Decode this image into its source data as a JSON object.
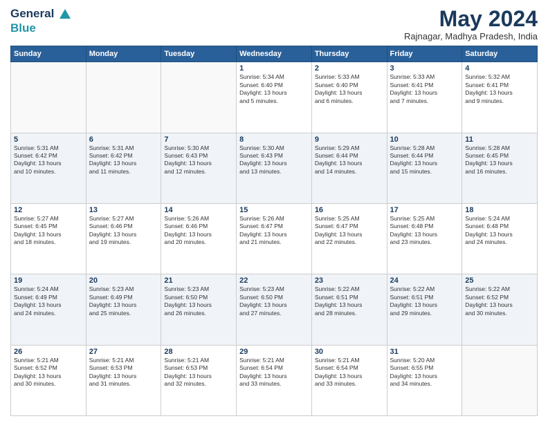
{
  "logo": {
    "line1": "General",
    "line2": "Blue"
  },
  "header": {
    "month_year": "May 2024",
    "location": "Rajnagar, Madhya Pradesh, India"
  },
  "days_of_week": [
    "Sunday",
    "Monday",
    "Tuesday",
    "Wednesday",
    "Thursday",
    "Friday",
    "Saturday"
  ],
  "weeks": [
    [
      {
        "day": "",
        "info": ""
      },
      {
        "day": "",
        "info": ""
      },
      {
        "day": "",
        "info": ""
      },
      {
        "day": "1",
        "info": "Sunrise: 5:34 AM\nSunset: 6:40 PM\nDaylight: 13 hours\nand 5 minutes."
      },
      {
        "day": "2",
        "info": "Sunrise: 5:33 AM\nSunset: 6:40 PM\nDaylight: 13 hours\nand 6 minutes."
      },
      {
        "day": "3",
        "info": "Sunrise: 5:33 AM\nSunset: 6:41 PM\nDaylight: 13 hours\nand 7 minutes."
      },
      {
        "day": "4",
        "info": "Sunrise: 5:32 AM\nSunset: 6:41 PM\nDaylight: 13 hours\nand 9 minutes."
      }
    ],
    [
      {
        "day": "5",
        "info": "Sunrise: 5:31 AM\nSunset: 6:42 PM\nDaylight: 13 hours\nand 10 minutes."
      },
      {
        "day": "6",
        "info": "Sunrise: 5:31 AM\nSunset: 6:42 PM\nDaylight: 13 hours\nand 11 minutes."
      },
      {
        "day": "7",
        "info": "Sunrise: 5:30 AM\nSunset: 6:43 PM\nDaylight: 13 hours\nand 12 minutes."
      },
      {
        "day": "8",
        "info": "Sunrise: 5:30 AM\nSunset: 6:43 PM\nDaylight: 13 hours\nand 13 minutes."
      },
      {
        "day": "9",
        "info": "Sunrise: 5:29 AM\nSunset: 6:44 PM\nDaylight: 13 hours\nand 14 minutes."
      },
      {
        "day": "10",
        "info": "Sunrise: 5:28 AM\nSunset: 6:44 PM\nDaylight: 13 hours\nand 15 minutes."
      },
      {
        "day": "11",
        "info": "Sunrise: 5:28 AM\nSunset: 6:45 PM\nDaylight: 13 hours\nand 16 minutes."
      }
    ],
    [
      {
        "day": "12",
        "info": "Sunrise: 5:27 AM\nSunset: 6:45 PM\nDaylight: 13 hours\nand 18 minutes."
      },
      {
        "day": "13",
        "info": "Sunrise: 5:27 AM\nSunset: 6:46 PM\nDaylight: 13 hours\nand 19 minutes."
      },
      {
        "day": "14",
        "info": "Sunrise: 5:26 AM\nSunset: 6:46 PM\nDaylight: 13 hours\nand 20 minutes."
      },
      {
        "day": "15",
        "info": "Sunrise: 5:26 AM\nSunset: 6:47 PM\nDaylight: 13 hours\nand 21 minutes."
      },
      {
        "day": "16",
        "info": "Sunrise: 5:25 AM\nSunset: 6:47 PM\nDaylight: 13 hours\nand 22 minutes."
      },
      {
        "day": "17",
        "info": "Sunrise: 5:25 AM\nSunset: 6:48 PM\nDaylight: 13 hours\nand 23 minutes."
      },
      {
        "day": "18",
        "info": "Sunrise: 5:24 AM\nSunset: 6:48 PM\nDaylight: 13 hours\nand 24 minutes."
      }
    ],
    [
      {
        "day": "19",
        "info": "Sunrise: 5:24 AM\nSunset: 6:49 PM\nDaylight: 13 hours\nand 24 minutes."
      },
      {
        "day": "20",
        "info": "Sunrise: 5:23 AM\nSunset: 6:49 PM\nDaylight: 13 hours\nand 25 minutes."
      },
      {
        "day": "21",
        "info": "Sunrise: 5:23 AM\nSunset: 6:50 PM\nDaylight: 13 hours\nand 26 minutes."
      },
      {
        "day": "22",
        "info": "Sunrise: 5:23 AM\nSunset: 6:50 PM\nDaylight: 13 hours\nand 27 minutes."
      },
      {
        "day": "23",
        "info": "Sunrise: 5:22 AM\nSunset: 6:51 PM\nDaylight: 13 hours\nand 28 minutes."
      },
      {
        "day": "24",
        "info": "Sunrise: 5:22 AM\nSunset: 6:51 PM\nDaylight: 13 hours\nand 29 minutes."
      },
      {
        "day": "25",
        "info": "Sunrise: 5:22 AM\nSunset: 6:52 PM\nDaylight: 13 hours\nand 30 minutes."
      }
    ],
    [
      {
        "day": "26",
        "info": "Sunrise: 5:21 AM\nSunset: 6:52 PM\nDaylight: 13 hours\nand 30 minutes."
      },
      {
        "day": "27",
        "info": "Sunrise: 5:21 AM\nSunset: 6:53 PM\nDaylight: 13 hours\nand 31 minutes."
      },
      {
        "day": "28",
        "info": "Sunrise: 5:21 AM\nSunset: 6:53 PM\nDaylight: 13 hours\nand 32 minutes."
      },
      {
        "day": "29",
        "info": "Sunrise: 5:21 AM\nSunset: 6:54 PM\nDaylight: 13 hours\nand 33 minutes."
      },
      {
        "day": "30",
        "info": "Sunrise: 5:21 AM\nSunset: 6:54 PM\nDaylight: 13 hours\nand 33 minutes."
      },
      {
        "day": "31",
        "info": "Sunrise: 5:20 AM\nSunset: 6:55 PM\nDaylight: 13 hours\nand 34 minutes."
      },
      {
        "day": "",
        "info": ""
      }
    ]
  ]
}
